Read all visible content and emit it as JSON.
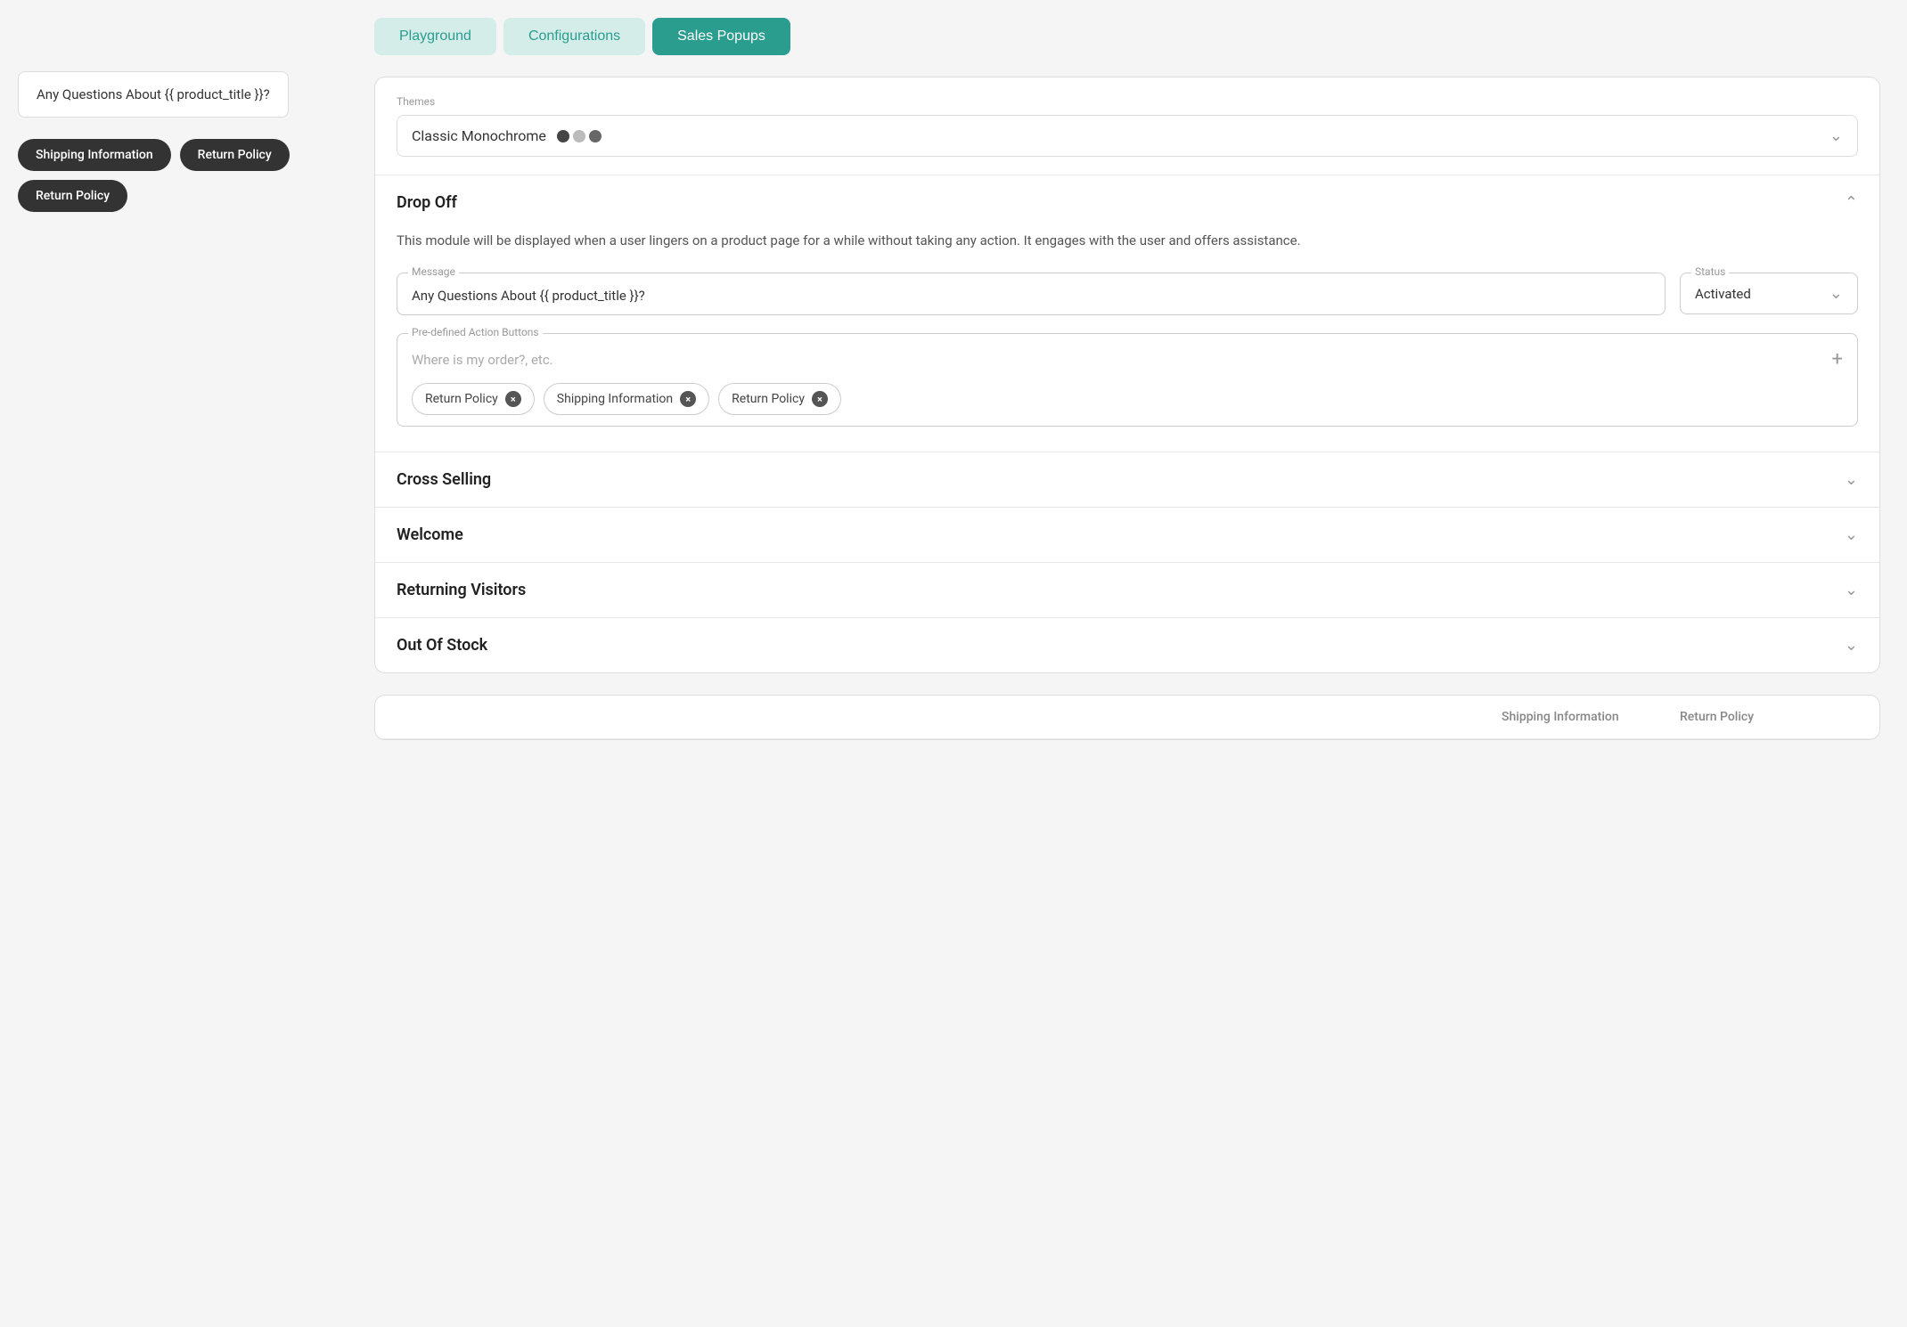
{
  "left_panel": {
    "preview_message": "Any Questions About {{ product_title }}?",
    "tags": [
      {
        "label": "Shipping Information"
      },
      {
        "label": "Return Policy"
      },
      {
        "label": "Return Policy"
      }
    ]
  },
  "tabs": [
    {
      "label": "Playground",
      "key": "playground"
    },
    {
      "label": "Configurations",
      "key": "configurations"
    },
    {
      "label": "Sales Popups",
      "key": "sales-popups",
      "active": true
    }
  ],
  "themes": {
    "section_label": "Themes",
    "selected": "Classic Monochrome"
  },
  "drop_off": {
    "title": "Drop Off",
    "description": "This module will be displayed when a user lingers on a product page for a while without taking any action. It engages with the user and offers assistance.",
    "message_label": "Message",
    "message_value": "Any Questions About {{ product_title }}?",
    "status_label": "Status",
    "status_value": "Activated",
    "predefined_label": "Pre-defined Action Buttons",
    "predefined_placeholder": "Where is my order?, etc.",
    "action_tags": [
      {
        "label": "Return Policy"
      },
      {
        "label": "Shipping Information"
      },
      {
        "label": "Return Policy"
      }
    ]
  },
  "collapsed_sections": [
    {
      "title": "Cross Selling"
    },
    {
      "title": "Welcome"
    },
    {
      "title": "Returning Visitors"
    },
    {
      "title": "Out Of Stock"
    }
  ],
  "bottom_table": {
    "columns": [
      "",
      "Shipping Information",
      "Return Policy"
    ]
  },
  "icons": {
    "chevron_down": "&#8964;",
    "chevron_up": "&#8963;",
    "plus": "+",
    "close": "&#215;"
  }
}
